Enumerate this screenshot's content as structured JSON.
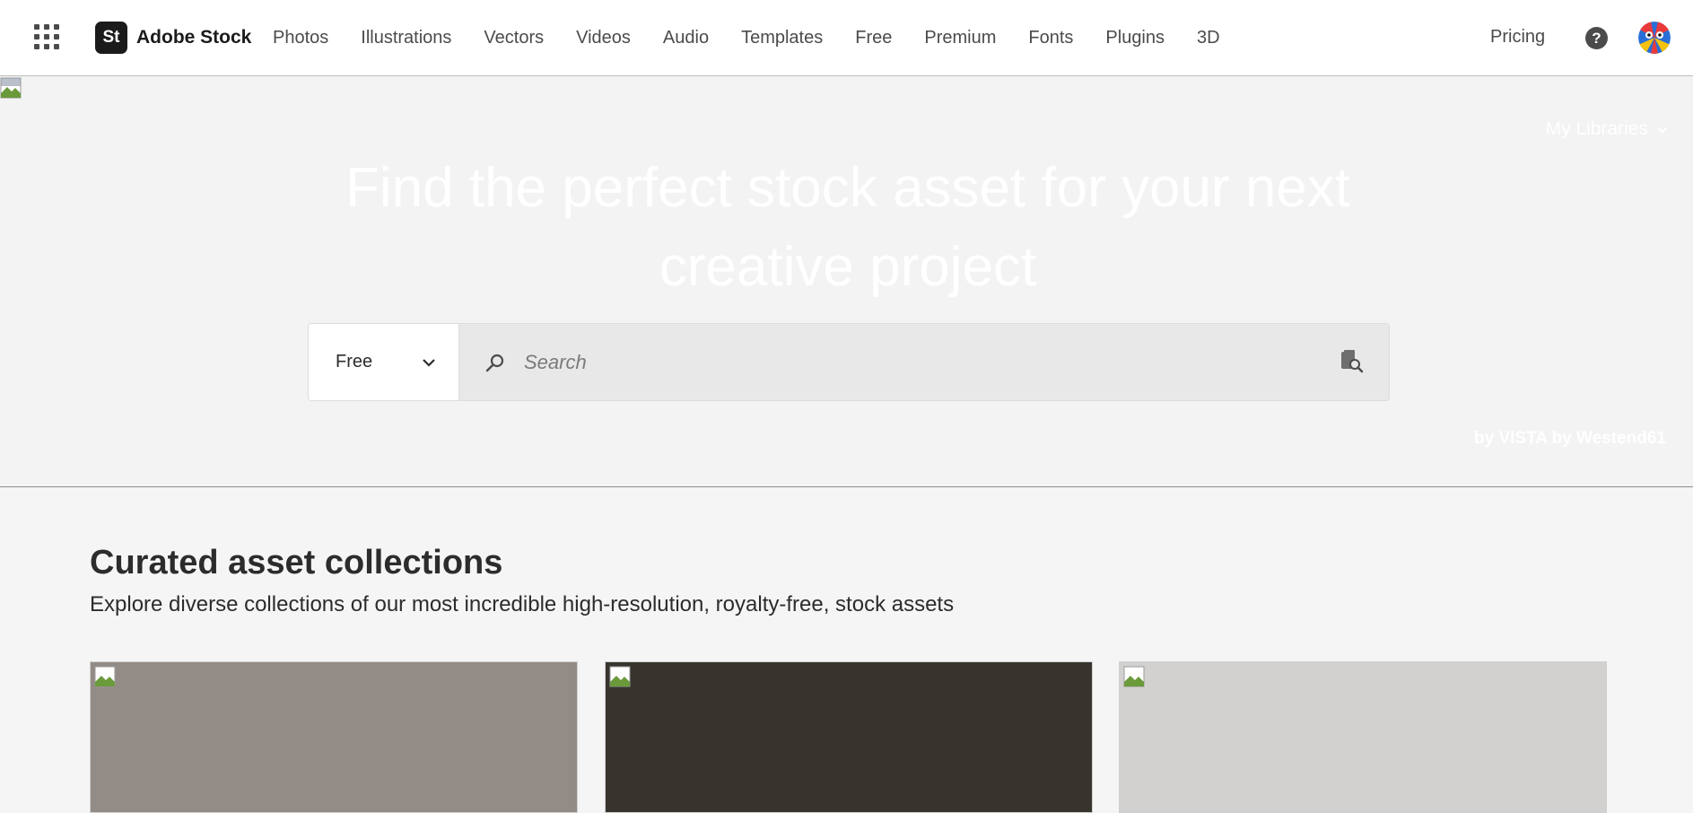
{
  "nav": {
    "brand_logo_text": "St",
    "brand_name": "Adobe Stock",
    "links": [
      "Photos",
      "Illustrations",
      "Vectors",
      "Videos",
      "Audio",
      "Templates",
      "Free",
      "Premium",
      "Fonts",
      "Plugins",
      "3D"
    ],
    "pricing": "Pricing",
    "help_glyph": "?"
  },
  "hero": {
    "my_libraries": "My Libraries",
    "title": "Find the perfect stock asset for your next creative project",
    "search": {
      "filter_value": "Free",
      "placeholder": "Search"
    },
    "credit": "by VISTA by Westend61"
  },
  "curated": {
    "title": "Curated asset collections",
    "subtitle": "Explore diverse collections of our most incredible high-resolution, royalty-free, stock assets",
    "cards": [
      {
        "color": "#938b85"
      },
      {
        "color": "#37342e"
      },
      {
        "color": "#d2d1cf"
      }
    ]
  },
  "icons": {
    "app_switcher": "grid-icon",
    "search": "search-icon",
    "visual_search": "visual-search-icon",
    "chevron": "chevron-down-icon",
    "help": "help-icon"
  },
  "colors": {
    "hero_bg": "#f3f3f3",
    "search_field_bg": "#e8e8e8",
    "brand_logo_bg": "#1b1b1b"
  }
}
